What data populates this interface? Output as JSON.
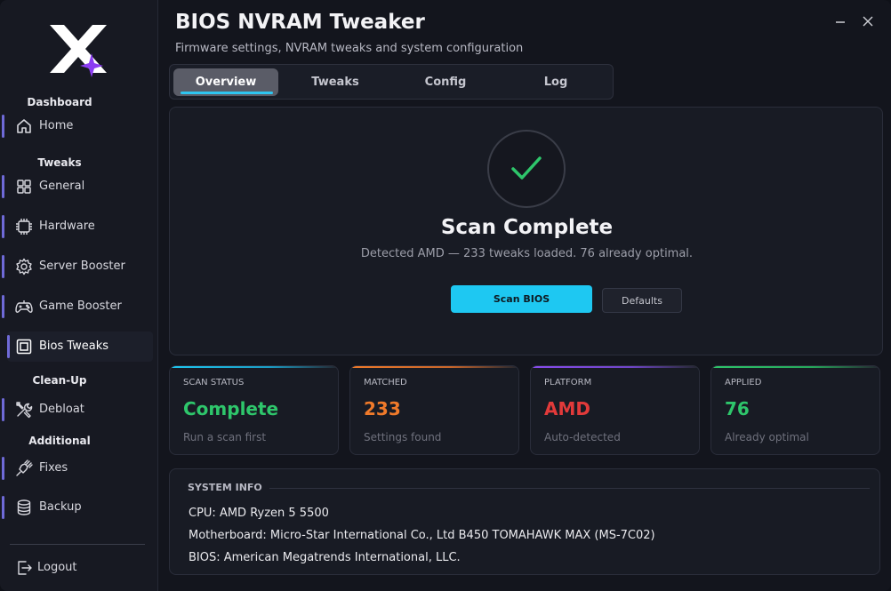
{
  "app": {
    "title": "BIOS NVRAM Tweaker",
    "subtitle": "Firmware settings, NVRAM tweaks and system configuration"
  },
  "sidebar": {
    "sections": {
      "dashboard": "Dashboard",
      "tweaks": "Tweaks",
      "cleanup": "Clean-Up",
      "additional": "Additional"
    },
    "items": [
      {
        "label": "Home",
        "icon": "home-icon"
      },
      {
        "label": "General",
        "icon": "grid-icon"
      },
      {
        "label": "Hardware",
        "icon": "chip-icon"
      },
      {
        "label": "Server Booster",
        "icon": "gear-icon"
      },
      {
        "label": "Game Booster",
        "icon": "gamepad-icon"
      },
      {
        "label": "Bios Tweaks",
        "icon": "bios-chip-icon",
        "active": true
      },
      {
        "label": "Debloat",
        "icon": "tools-icon"
      },
      {
        "label": "Fixes",
        "icon": "plug-icon"
      },
      {
        "label": "Backup",
        "icon": "database-icon"
      }
    ],
    "logout": "Logout"
  },
  "tabs": [
    {
      "label": "Overview",
      "active": true
    },
    {
      "label": "Tweaks"
    },
    {
      "label": "Config"
    },
    {
      "label": "Log"
    }
  ],
  "scan": {
    "title": "Scan Complete",
    "description": "Detected AMD — 233 tweaks loaded. 76 already optimal.",
    "primary_button": "Scan BIOS",
    "secondary_button": "Defaults"
  },
  "stats": [
    {
      "label": "SCAN STATUS",
      "value": "Complete",
      "hint": "Run a scan first",
      "color": "#2ec66b"
    },
    {
      "label": "MATCHED",
      "value": "233",
      "hint": "Settings found",
      "color": "#f07a2a"
    },
    {
      "label": "PLATFORM",
      "value": "AMD",
      "hint": "Auto-detected",
      "color": "#e23a3a"
    },
    {
      "label": "APPLIED",
      "value": "76",
      "hint": "Already optimal",
      "color": "#2ec66b"
    }
  ],
  "system_info": {
    "heading": "SYSTEM INFO",
    "cpu": "CPU: AMD Ryzen 5 5500",
    "motherboard": "Motherboard: Micro-Star International Co., Ltd B450 TOMAHAWK MAX (MS-7C02)",
    "bios": "BIOS: American Megatrends International, LLC."
  },
  "colors": {
    "accent": "#1ec8f2",
    "nav_bar": "#6f6ad8",
    "success": "#2ec66b"
  }
}
